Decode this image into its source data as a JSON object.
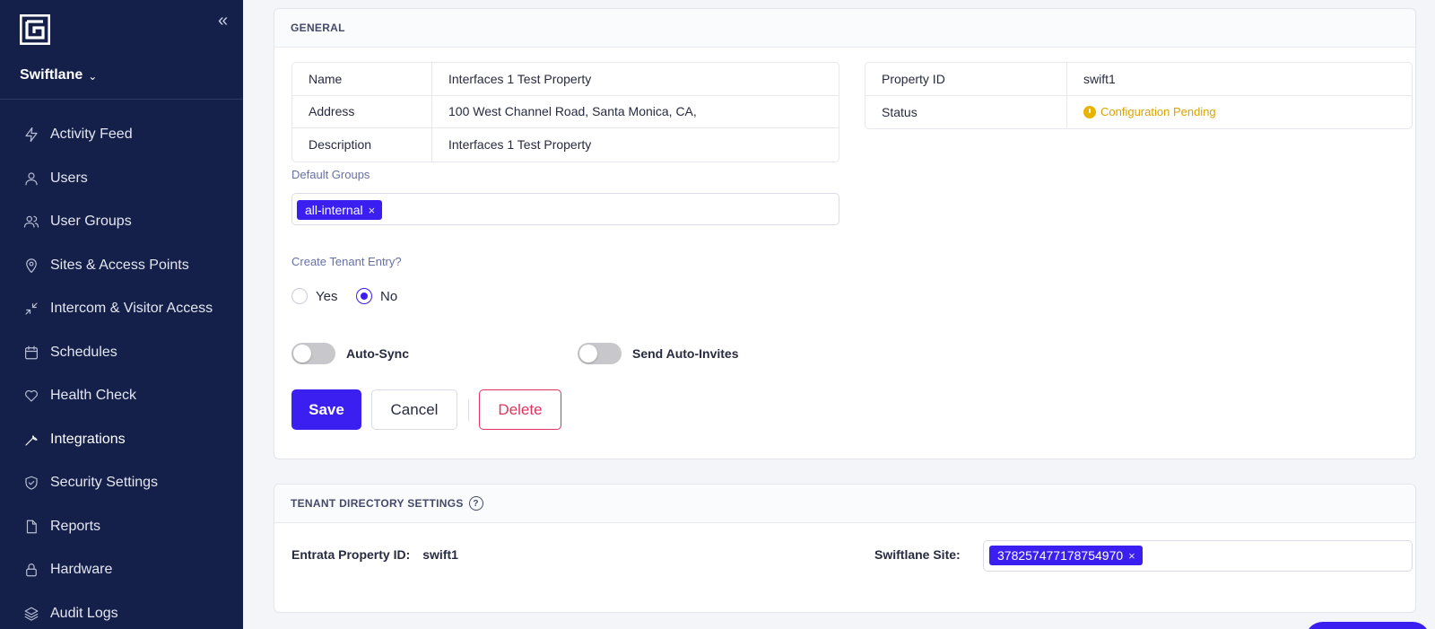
{
  "sidebar": {
    "org_name": "Swiftlane",
    "collapse_glyph": "«",
    "items": [
      {
        "label": "Activity Feed",
        "icon": "bolt-icon"
      },
      {
        "label": "Users",
        "icon": "user-icon"
      },
      {
        "label": "User Groups",
        "icon": "users-icon"
      },
      {
        "label": "Sites & Access Points",
        "icon": "map-pin-icon"
      },
      {
        "label": "Intercom & Visitor Access",
        "icon": "arrows-in-icon"
      },
      {
        "label": "Schedules",
        "icon": "calendar-icon"
      },
      {
        "label": "Health Check",
        "icon": "heart-icon"
      },
      {
        "label": "Integrations",
        "icon": "wrench-icon"
      },
      {
        "label": "Security Settings",
        "icon": "shield-icon"
      },
      {
        "label": "Reports",
        "icon": "file-icon"
      },
      {
        "label": "Hardware",
        "icon": "lock-icon"
      },
      {
        "label": "Audit Logs",
        "icon": "layers-icon"
      }
    ],
    "active_item": "Integrations"
  },
  "general": {
    "title": "GENERAL",
    "left_table": [
      {
        "key": "Name",
        "value": "Interfaces 1 Test Property"
      },
      {
        "key": "Address",
        "value": "100 West Channel Road, Santa Monica, CA,"
      },
      {
        "key": "Description",
        "value": "Interfaces 1 Test Property"
      }
    ],
    "right_table": {
      "property_id_key": "Property ID",
      "property_id_value": "swift1",
      "status_key": "Status",
      "status_value": "Configuration Pending"
    },
    "default_groups_label": "Default Groups",
    "default_groups": [
      "all-internal"
    ],
    "tag_remove_glyph": "×",
    "create_tenant_label": "Create Tenant Entry?",
    "radio_yes": "Yes",
    "radio_no": "No",
    "radio_selected": "No",
    "auto_sync_label": "Auto-Sync",
    "auto_sync_on": false,
    "send_invites_label": "Send Auto-Invites",
    "send_invites_on": false,
    "save_label": "Save",
    "cancel_label": "Cancel",
    "delete_label": "Delete"
  },
  "tenant_directory": {
    "title": "TENANT DIRECTORY SETTINGS",
    "help_glyph": "?",
    "entrata_label": "Entrata Property ID:",
    "entrata_value": "swift1",
    "site_label": "Swiftlane Site:",
    "site_tag": "378257477178754970"
  },
  "colors": {
    "sidebar_bg": "#14204a",
    "primary": "#3a1ff0",
    "danger": "#e0335f",
    "pending": "#d9a400"
  }
}
